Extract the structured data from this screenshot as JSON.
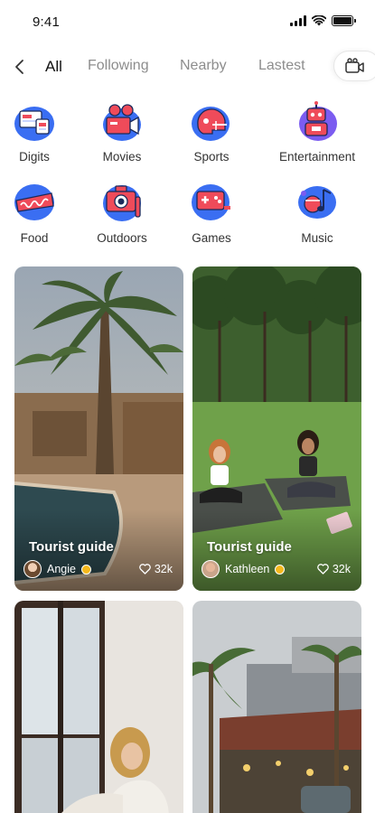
{
  "status": {
    "time": "9:41"
  },
  "nav": {
    "tabs": [
      {
        "label": "All",
        "active": true
      },
      {
        "label": "Following",
        "active": false
      },
      {
        "label": "Nearby",
        "active": false
      },
      {
        "label": "Lastest",
        "active": false
      }
    ]
  },
  "categories": [
    {
      "label": "Digits",
      "icon": "digits-icon"
    },
    {
      "label": "Movies",
      "icon": "movie-camera-icon"
    },
    {
      "label": "Sports",
      "icon": "helmet-icon"
    },
    {
      "label": "Entertainment",
      "icon": "robot-icon"
    },
    {
      "label": "Food",
      "icon": "food-icon"
    },
    {
      "label": "Outdoors",
      "icon": "outdoor-camera-icon"
    },
    {
      "label": "Games",
      "icon": "gamepad-icon"
    },
    {
      "label": "Music",
      "icon": "music-icon"
    }
  ],
  "feed": [
    {
      "title": "Tourist guide",
      "author": "Angie",
      "likes": "32k"
    },
    {
      "title": "Tourist guide",
      "author": "Kathleen",
      "likes": "32k"
    },
    {
      "title": "",
      "author": "",
      "likes": ""
    },
    {
      "title": "",
      "author": "",
      "likes": ""
    }
  ],
  "colors": {
    "accent": "#2f6cf6",
    "icon_red": "#ef4b5a",
    "icon_blue": "#3a6ef2",
    "icon_purple": "#7b5cf0",
    "badge": "#f5b81c"
  }
}
